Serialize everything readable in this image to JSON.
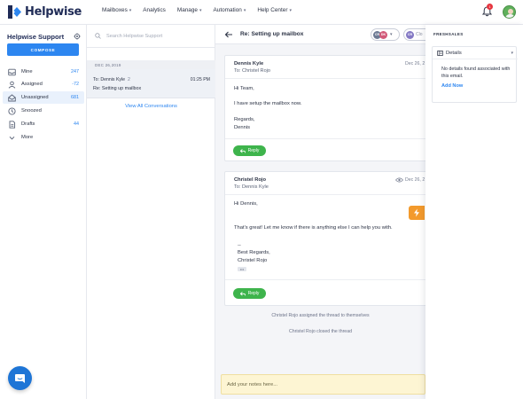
{
  "brand": {
    "name": "Helpwise",
    "color": "#1f2b56",
    "accent": "#2d86f0"
  },
  "nav": {
    "items": [
      {
        "label": "Mailboxes",
        "dropdown": true
      },
      {
        "label": "Analytics",
        "dropdown": false
      },
      {
        "label": "Manage",
        "dropdown": true
      },
      {
        "label": "Automation",
        "dropdown": true
      },
      {
        "label": "Help Center",
        "dropdown": true
      }
    ],
    "notification_count": "1",
    "notification_icon": "bell-icon",
    "avatar_icon": "user-avatar"
  },
  "sidebar": {
    "inbox_title": "Helpwise Support",
    "compose_label": "COMPOSE",
    "folders": [
      {
        "label": "Mine",
        "count": "247",
        "icon": "inbox-icon"
      },
      {
        "label": "Assigned",
        "count": "-72",
        "icon": "user-icon"
      },
      {
        "label": "Unassigned",
        "count": "681",
        "icon": "unassigned-inbox-icon",
        "active": true
      },
      {
        "label": "Snoozed",
        "count": "",
        "icon": "clock-icon"
      },
      {
        "label": "Drafts",
        "count": "44",
        "icon": "draft-icon"
      },
      {
        "label": "More",
        "count": "",
        "icon": "chevron-down-icon"
      }
    ]
  },
  "conversations": {
    "search_placeholder": "Search Helpwise Support",
    "date_group": "DEC 26,2019",
    "items": [
      {
        "to": "To: Dennis Kyle",
        "count": "2",
        "time": "01:25 PM",
        "subject": "Re: Setting up mailbox"
      }
    ],
    "view_all_label": "View All Conversations"
  },
  "thread": {
    "subject": "Re: Setting up mailbox",
    "assignee_initials": [
      "CR",
      "DK"
    ],
    "status_initials": "CR",
    "status_label": "Clo",
    "messages": [
      {
        "from": "Dennis Kyle",
        "to": "To: Christel Rojo",
        "date": "Dec 26, 2",
        "body": [
          "Hi Team,",
          "I have setup the mailbox now.",
          "Regards,",
          "Dennis"
        ],
        "reply_label": "Reply"
      },
      {
        "from": "Christel Rojo",
        "to": "To: Dennis Kyle",
        "date": "Dec 26, 2",
        "body": [
          "Hi Dennis,",
          "That's great! Let me know if there is anything else I can help you with.",
          "--",
          "Best Regards,",
          "Christel Rojo"
        ],
        "ellipsis": "•••",
        "reply_label": "Reply"
      }
    ],
    "activity": [
      "Christel Rojo assigned the thread to themselves",
      "Christel Rojo closed the thread"
    ],
    "notes_placeholder": "Add your notes here..."
  },
  "right_panel": {
    "title": "FRESHSALES",
    "card_title": "Details",
    "empty_text": "No details found associated with this email.",
    "add_label": "Add Now"
  },
  "colors": {
    "reply_green": "#3eb44c",
    "notes_bg": "#fdf5d3",
    "lightning": "#f39a2c",
    "chat": "#1e75d6"
  }
}
